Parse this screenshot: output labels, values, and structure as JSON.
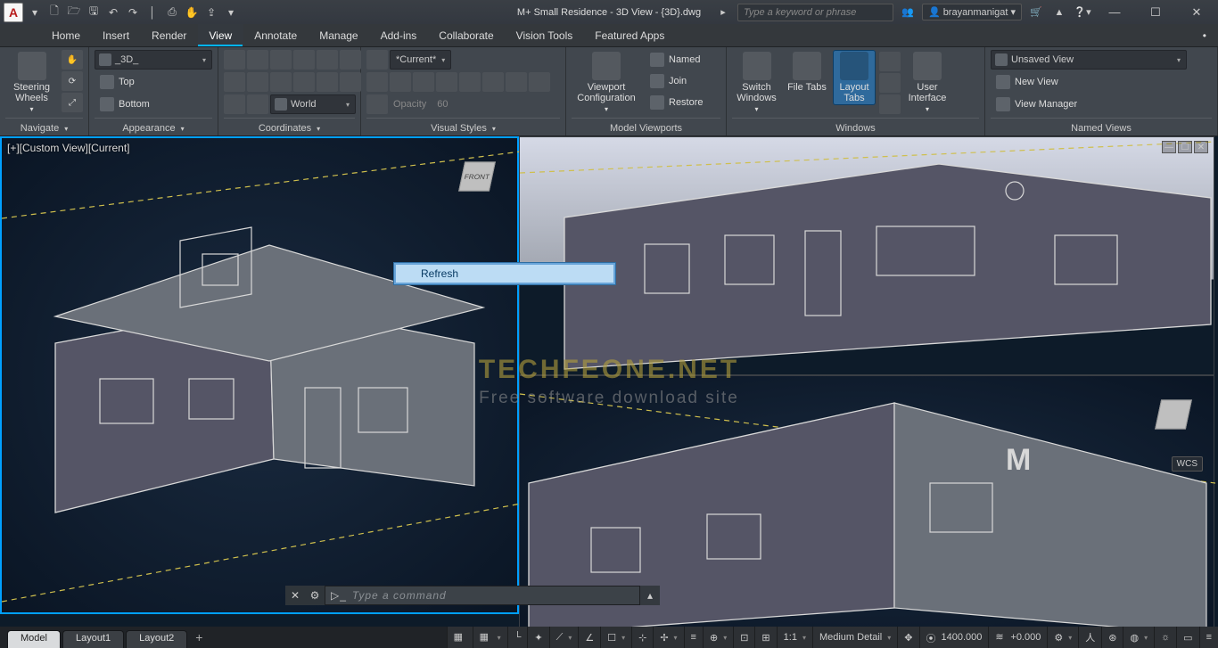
{
  "titlebar": {
    "app_logo": "A",
    "title": "M+ Small Residence - 3D View - {3D}.dwg",
    "search_placeholder": "Type a keyword or phrase",
    "user_name": "brayanmanigat"
  },
  "menu": {
    "tabs": [
      {
        "label": "Home"
      },
      {
        "label": "Insert"
      },
      {
        "label": "Render"
      },
      {
        "label": "View",
        "active": true
      },
      {
        "label": "Annotate"
      },
      {
        "label": "Manage"
      },
      {
        "label": "Add-ins"
      },
      {
        "label": "Collaborate"
      },
      {
        "label": "Vision Tools"
      },
      {
        "label": "Featured Apps"
      }
    ]
  },
  "ribbon": {
    "navigate": {
      "big_label": "Steering\nWheels",
      "panel_title": "Navigate"
    },
    "appearance": {
      "view_sel": "_3D_",
      "top": "Top",
      "bottom": "Bottom",
      "panel_title": "Appearance"
    },
    "coordinates": {
      "world": "World",
      "panel_title": "Coordinates"
    },
    "visual_styles": {
      "current": "*Current*",
      "opacity_lbl": "Opacity",
      "opacity_val": "60",
      "panel_title": "Visual Styles"
    },
    "viewports": {
      "config": "Viewport\nConfiguration",
      "named": "Named",
      "join": "Join",
      "restore": "Restore",
      "panel_title": "Model Viewports"
    },
    "windows": {
      "switch": "Switch\nWindows",
      "file_tabs": "File Tabs",
      "layout_tabs": "Layout\nTabs",
      "ui": "User\nInterface",
      "panel_title": "Windows"
    },
    "named_views": {
      "sel": "Unsaved View",
      "new": "New View",
      "mgr": "View Manager",
      "panel_title": "Named Views"
    }
  },
  "viewport": {
    "left_label": "[+][Custom View][Current]",
    "wcs": "WCS",
    "cube_face": "FRONT",
    "refresh": "Refresh"
  },
  "watermark": {
    "line1": "TECHFEONE.NET",
    "line2": "Free software download site"
  },
  "commandline": {
    "placeholder": "Type a command"
  },
  "sheettabs": {
    "tabs": [
      {
        "label": "Model",
        "active": true
      },
      {
        "label": "Layout1"
      },
      {
        "label": "Layout2"
      }
    ]
  },
  "status": {
    "coord": "1400.000",
    "angle": "+0.000",
    "scale": "1:1",
    "detail": "Medium Detail"
  }
}
